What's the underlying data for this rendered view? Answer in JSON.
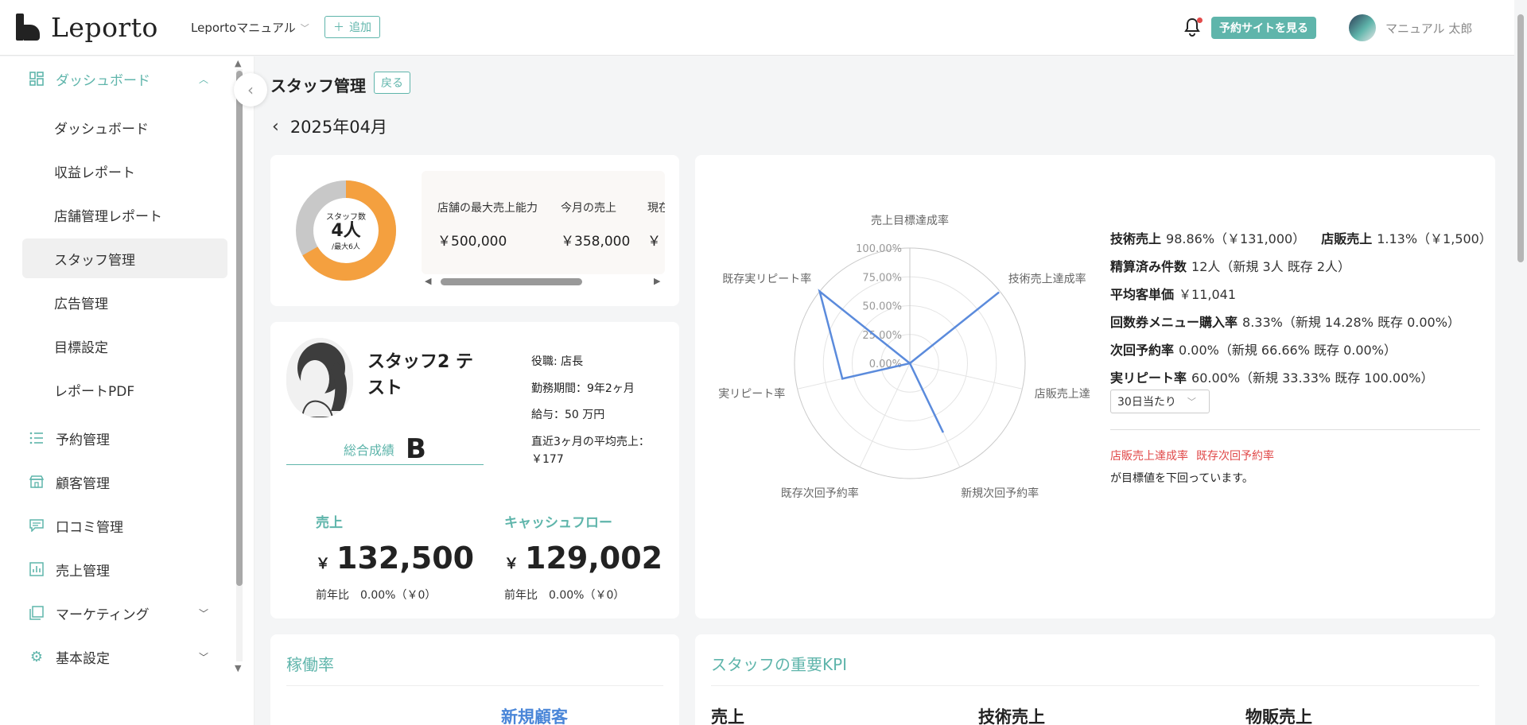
{
  "header": {
    "logo_text": "Leporto",
    "store_select": "Leportoマニュアル",
    "add_label": "追加",
    "site_button": "予約サイトを見る",
    "user_name": "マニュアル 太郎"
  },
  "sidebar": {
    "groups": [
      {
        "label": "ダッシュボード",
        "icon": "dashboard-icon",
        "expanded": true
      },
      {
        "label": "予約管理",
        "icon": "list-icon"
      },
      {
        "label": "顧客管理",
        "icon": "store-icon"
      },
      {
        "label": "口コミ管理",
        "icon": "comment-icon"
      },
      {
        "label": "売上管理",
        "icon": "chart-icon"
      },
      {
        "label": "マーケティング",
        "icon": "layers-icon",
        "collapsible": true
      },
      {
        "label": "基本設定",
        "icon": "gear-icon",
        "collapsible": true
      }
    ],
    "sub_items": [
      {
        "label": "ダッシュボード"
      },
      {
        "label": "収益レポート"
      },
      {
        "label": "店舗管理レポート"
      },
      {
        "label": "スタッフ管理",
        "selected": true
      },
      {
        "label": "広告管理"
      },
      {
        "label": "目標設定"
      },
      {
        "label": "レポートPDF"
      }
    ]
  },
  "page": {
    "title": "スタッフ管理",
    "back_label": "戻る",
    "month": "2025年04月"
  },
  "capacity": {
    "donut_label": "スタッフ数",
    "donut_count": "4人",
    "donut_max": "/最大6人",
    "donut_fraction": 0.6667,
    "donut_color": "#f4a03f",
    "donut_rest_color": "#c8c8c8",
    "stats": [
      {
        "label": "店舗の最大売上能力",
        "value": "￥500,000"
      },
      {
        "label": "今月の売上",
        "value": "￥358,000"
      },
      {
        "label": "現在",
        "value": "￥"
      }
    ]
  },
  "staff": {
    "name": "スタッフ2 テスト",
    "overall_label": "総合成績",
    "overall_grade": "B",
    "position": "役職: 店長",
    "tenure": "勤務期間：9年2ヶ月",
    "salary": "給与：50 万円",
    "avg_sales": "直近3ヶ月の平均売上：￥177",
    "sales_label": "売上",
    "sales_currency": "￥",
    "sales_value": "132,500",
    "sales_yoy": "前年比　0.00%（￥0）",
    "cf_label": "キャッシュフロー",
    "cf_currency": "￥",
    "cf_value": "129,002",
    "cf_yoy": "前年比　0.00%（￥0）"
  },
  "chart_data": {
    "type": "radar",
    "axes": [
      "売上目標達成率",
      "技術売上達成率",
      "店販売上達",
      "新規次回予約率",
      "既存次回予約率",
      "実リピート率",
      "既存実リピート率"
    ],
    "tick_labels": [
      "0.00%",
      "25.00%",
      "50.00%",
      "75.00%",
      "100.00%"
    ],
    "range": [
      0,
      100
    ],
    "series": [
      {
        "values": [
          0,
          98.86,
          0,
          66.66,
          0,
          60,
          100
        ],
        "color": "#5b8bdc"
      }
    ]
  },
  "metrics": {
    "row1": {
      "k1": "技術売上",
      "v1": "98.86%（￥131,000）",
      "k2": "店販売上",
      "v2": "1.13%（￥1,500）"
    },
    "row2": {
      "k": "精算済み件数",
      "v": "12人（新規 3人 既存 2人）"
    },
    "row3": {
      "k": "平均客単価",
      "v": "￥11,041"
    },
    "row4": {
      "k": "回数券メニュー購入率",
      "v": "8.33%（新規 14.28% 既存 0.00%）"
    },
    "row5": {
      "k": "次回予約率",
      "v": "0.00%（新規 66.66% 既存 0.00%）"
    },
    "row6": {
      "k": "実リピート率",
      "v": "60.00%（新規 33.33% 既存 100.00%）"
    },
    "period": "30日当たり",
    "alerts": [
      "店販売上達成率",
      "既存次回予約率"
    ],
    "alert_text": "が目標値を下回っています。"
  },
  "utilization": {
    "title": "稼働率",
    "new_customer": "新規顧客"
  },
  "kpi": {
    "title": "スタッフの重要KPI",
    "heads": [
      "売上",
      "技術売上",
      "物販売上"
    ]
  }
}
